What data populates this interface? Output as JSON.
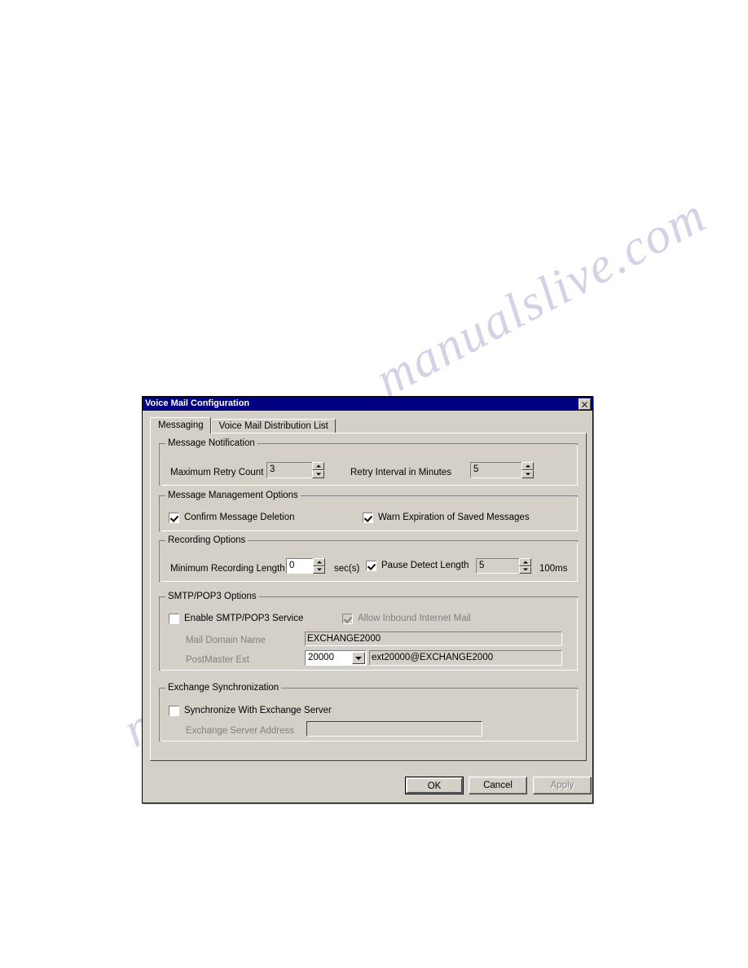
{
  "page": {
    "watermark_top": "manualslive.com",
    "watermark_bottom": "manualslive.com"
  },
  "dialog": {
    "title": "Voice Mail Configuration",
    "close_icon": "×",
    "tabs": [
      {
        "label": "Messaging",
        "active": true
      },
      {
        "label": "Voice Mail Distribution List",
        "active": false
      }
    ],
    "groups": {
      "message_notification": {
        "title": "Message Notification",
        "max_retry_label": "Maximum Retry Count",
        "max_retry_value": "3",
        "retry_interval_label": "Retry Interval in Minutes",
        "retry_interval_value": "5"
      },
      "message_management": {
        "title": "Message Management Options",
        "confirm_deletion_label": "Confirm Message Deletion",
        "confirm_deletion_checked": true,
        "warn_expiration_label": "Warn Expiration of Saved Messages",
        "warn_expiration_checked": true
      },
      "recording_options": {
        "title": "Recording Options",
        "min_recording_label": "Minimum Recording Length",
        "min_recording_value": "0",
        "secs_unit": "sec(s)",
        "pause_detect_label": "Pause Detect Length",
        "pause_detect_checked": true,
        "pause_detect_value": "5",
        "pause_unit": "100ms"
      },
      "smtp_pop3": {
        "title": "SMTP/POP3 Options",
        "enable_service_label": "Enable SMTP/POP3 Service",
        "enable_service_checked": false,
        "allow_inbound_label": "Allow Inbound Internet Mail",
        "allow_inbound_checked": true,
        "mail_domain_label": "Mail Domain Name",
        "mail_domain_value": "EXCHANGE2000",
        "postmaster_label": "PostMaster Ext",
        "postmaster_value": "20000",
        "postmaster_email": "ext20000@EXCHANGE2000"
      },
      "exchange_sync": {
        "title": "Exchange Synchronization",
        "sync_label": "Synchronize With Exchange Server",
        "sync_checked": false,
        "server_address_label": "Exchange Server Address",
        "server_address_value": ""
      }
    },
    "buttons": {
      "ok": "OK",
      "cancel": "Cancel",
      "apply": "Apply"
    }
  }
}
